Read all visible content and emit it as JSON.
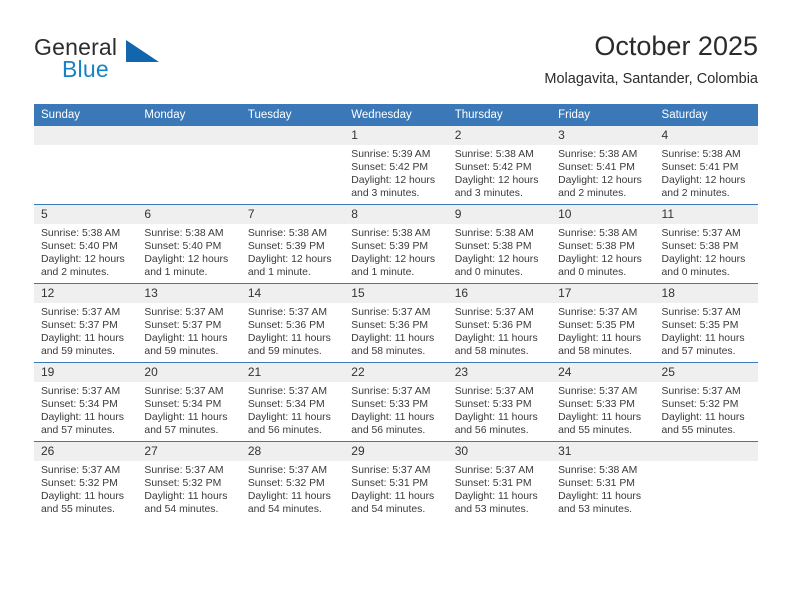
{
  "brand": {
    "name_primary": "General",
    "name_secondary": "Blue",
    "accent_color": "#1266ae",
    "text_blue": "#1883c4"
  },
  "header": {
    "title": "October 2025",
    "location": "Molagavita, Santander, Colombia"
  },
  "theme": {
    "header_row_bg": "#3b78b8",
    "daynum_bg": "#efefef",
    "grid_line": "#3b78b8"
  },
  "weekday_headers": [
    "Sunday",
    "Monday",
    "Tuesday",
    "Wednesday",
    "Thursday",
    "Friday",
    "Saturday"
  ],
  "labels": {
    "sunrise_prefix": "Sunrise:",
    "sunset_prefix": "Sunset:",
    "daylight_prefix": "Daylight:"
  },
  "weeks": [
    [
      {
        "day": "",
        "empty": true,
        "line1": "",
        "line2": "",
        "line3": "",
        "line4": ""
      },
      {
        "day": "",
        "empty": true,
        "line1": "",
        "line2": "",
        "line3": "",
        "line4": ""
      },
      {
        "day": "",
        "empty": true,
        "line1": "",
        "line2": "",
        "line3": "",
        "line4": ""
      },
      {
        "day": "1",
        "empty": false,
        "line1": "Sunrise: 5:39 AM",
        "line2": "Sunset: 5:42 PM",
        "line3": "Daylight: 12 hours",
        "line4": "and 3 minutes."
      },
      {
        "day": "2",
        "empty": false,
        "line1": "Sunrise: 5:38 AM",
        "line2": "Sunset: 5:42 PM",
        "line3": "Daylight: 12 hours",
        "line4": "and 3 minutes."
      },
      {
        "day": "3",
        "empty": false,
        "line1": "Sunrise: 5:38 AM",
        "line2": "Sunset: 5:41 PM",
        "line3": "Daylight: 12 hours",
        "line4": "and 2 minutes."
      },
      {
        "day": "4",
        "empty": false,
        "line1": "Sunrise: 5:38 AM",
        "line2": "Sunset: 5:41 PM",
        "line3": "Daylight: 12 hours",
        "line4": "and 2 minutes."
      }
    ],
    [
      {
        "day": "5",
        "empty": false,
        "line1": "Sunrise: 5:38 AM",
        "line2": "Sunset: 5:40 PM",
        "line3": "Daylight: 12 hours",
        "line4": "and 2 minutes."
      },
      {
        "day": "6",
        "empty": false,
        "line1": "Sunrise: 5:38 AM",
        "line2": "Sunset: 5:40 PM",
        "line3": "Daylight: 12 hours",
        "line4": "and 1 minute."
      },
      {
        "day": "7",
        "empty": false,
        "line1": "Sunrise: 5:38 AM",
        "line2": "Sunset: 5:39 PM",
        "line3": "Daylight: 12 hours",
        "line4": "and 1 minute."
      },
      {
        "day": "8",
        "empty": false,
        "line1": "Sunrise: 5:38 AM",
        "line2": "Sunset: 5:39 PM",
        "line3": "Daylight: 12 hours",
        "line4": "and 1 minute."
      },
      {
        "day": "9",
        "empty": false,
        "line1": "Sunrise: 5:38 AM",
        "line2": "Sunset: 5:38 PM",
        "line3": "Daylight: 12 hours",
        "line4": "and 0 minutes."
      },
      {
        "day": "10",
        "empty": false,
        "line1": "Sunrise: 5:38 AM",
        "line2": "Sunset: 5:38 PM",
        "line3": "Daylight: 12 hours",
        "line4": "and 0 minutes."
      },
      {
        "day": "11",
        "empty": false,
        "line1": "Sunrise: 5:37 AM",
        "line2": "Sunset: 5:38 PM",
        "line3": "Daylight: 12 hours",
        "line4": "and 0 minutes."
      }
    ],
    [
      {
        "day": "12",
        "empty": false,
        "line1": "Sunrise: 5:37 AM",
        "line2": "Sunset: 5:37 PM",
        "line3": "Daylight: 11 hours",
        "line4": "and 59 minutes."
      },
      {
        "day": "13",
        "empty": false,
        "line1": "Sunrise: 5:37 AM",
        "line2": "Sunset: 5:37 PM",
        "line3": "Daylight: 11 hours",
        "line4": "and 59 minutes."
      },
      {
        "day": "14",
        "empty": false,
        "line1": "Sunrise: 5:37 AM",
        "line2": "Sunset: 5:36 PM",
        "line3": "Daylight: 11 hours",
        "line4": "and 59 minutes."
      },
      {
        "day": "15",
        "empty": false,
        "line1": "Sunrise: 5:37 AM",
        "line2": "Sunset: 5:36 PM",
        "line3": "Daylight: 11 hours",
        "line4": "and 58 minutes."
      },
      {
        "day": "16",
        "empty": false,
        "line1": "Sunrise: 5:37 AM",
        "line2": "Sunset: 5:36 PM",
        "line3": "Daylight: 11 hours",
        "line4": "and 58 minutes."
      },
      {
        "day": "17",
        "empty": false,
        "line1": "Sunrise: 5:37 AM",
        "line2": "Sunset: 5:35 PM",
        "line3": "Daylight: 11 hours",
        "line4": "and 58 minutes."
      },
      {
        "day": "18",
        "empty": false,
        "line1": "Sunrise: 5:37 AM",
        "line2": "Sunset: 5:35 PM",
        "line3": "Daylight: 11 hours",
        "line4": "and 57 minutes."
      }
    ],
    [
      {
        "day": "19",
        "empty": false,
        "line1": "Sunrise: 5:37 AM",
        "line2": "Sunset: 5:34 PM",
        "line3": "Daylight: 11 hours",
        "line4": "and 57 minutes."
      },
      {
        "day": "20",
        "empty": false,
        "line1": "Sunrise: 5:37 AM",
        "line2": "Sunset: 5:34 PM",
        "line3": "Daylight: 11 hours",
        "line4": "and 57 minutes."
      },
      {
        "day": "21",
        "empty": false,
        "line1": "Sunrise: 5:37 AM",
        "line2": "Sunset: 5:34 PM",
        "line3": "Daylight: 11 hours",
        "line4": "and 56 minutes."
      },
      {
        "day": "22",
        "empty": false,
        "line1": "Sunrise: 5:37 AM",
        "line2": "Sunset: 5:33 PM",
        "line3": "Daylight: 11 hours",
        "line4": "and 56 minutes."
      },
      {
        "day": "23",
        "empty": false,
        "line1": "Sunrise: 5:37 AM",
        "line2": "Sunset: 5:33 PM",
        "line3": "Daylight: 11 hours",
        "line4": "and 56 minutes."
      },
      {
        "day": "24",
        "empty": false,
        "line1": "Sunrise: 5:37 AM",
        "line2": "Sunset: 5:33 PM",
        "line3": "Daylight: 11 hours",
        "line4": "and 55 minutes."
      },
      {
        "day": "25",
        "empty": false,
        "line1": "Sunrise: 5:37 AM",
        "line2": "Sunset: 5:32 PM",
        "line3": "Daylight: 11 hours",
        "line4": "and 55 minutes."
      }
    ],
    [
      {
        "day": "26",
        "empty": false,
        "line1": "Sunrise: 5:37 AM",
        "line2": "Sunset: 5:32 PM",
        "line3": "Daylight: 11 hours",
        "line4": "and 55 minutes."
      },
      {
        "day": "27",
        "empty": false,
        "line1": "Sunrise: 5:37 AM",
        "line2": "Sunset: 5:32 PM",
        "line3": "Daylight: 11 hours",
        "line4": "and 54 minutes."
      },
      {
        "day": "28",
        "empty": false,
        "line1": "Sunrise: 5:37 AM",
        "line2": "Sunset: 5:32 PM",
        "line3": "Daylight: 11 hours",
        "line4": "and 54 minutes."
      },
      {
        "day": "29",
        "empty": false,
        "line1": "Sunrise: 5:37 AM",
        "line2": "Sunset: 5:31 PM",
        "line3": "Daylight: 11 hours",
        "line4": "and 54 minutes."
      },
      {
        "day": "30",
        "empty": false,
        "line1": "Sunrise: 5:37 AM",
        "line2": "Sunset: 5:31 PM",
        "line3": "Daylight: 11 hours",
        "line4": "and 53 minutes."
      },
      {
        "day": "31",
        "empty": false,
        "line1": "Sunrise: 5:38 AM",
        "line2": "Sunset: 5:31 PM",
        "line3": "Daylight: 11 hours",
        "line4": "and 53 minutes."
      },
      {
        "day": "",
        "empty": true,
        "line1": "",
        "line2": "",
        "line3": "",
        "line4": ""
      }
    ]
  ]
}
